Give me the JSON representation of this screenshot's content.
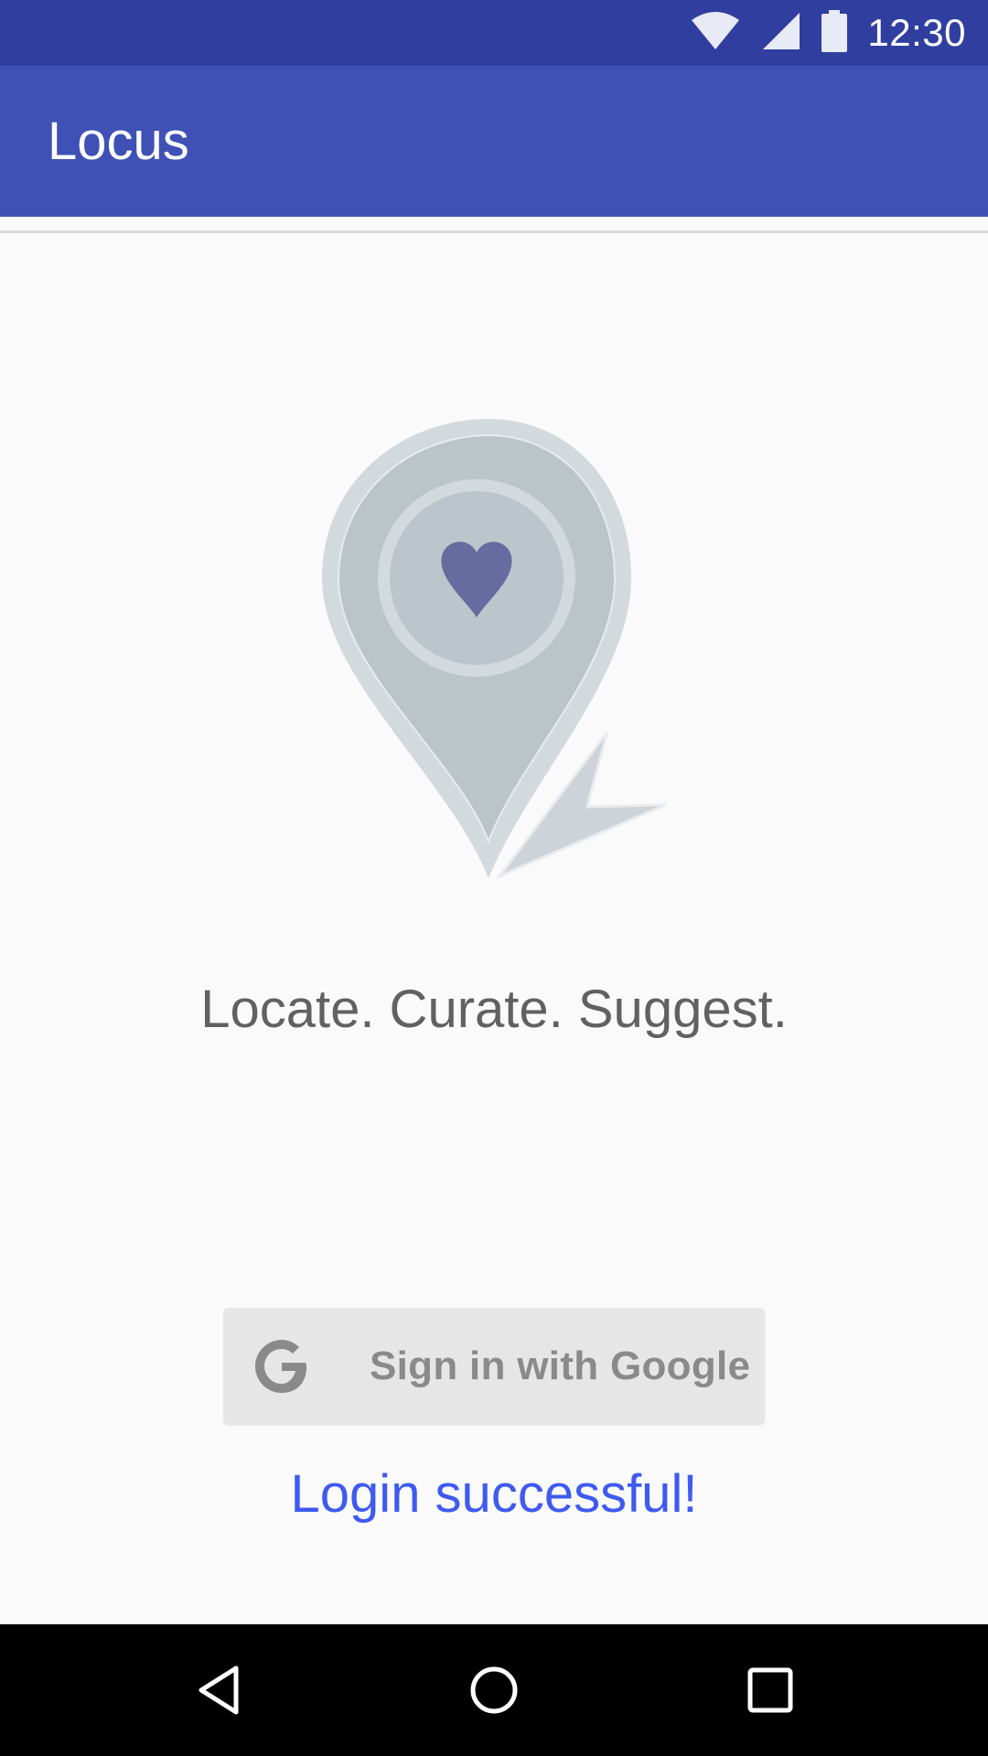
{
  "status_bar": {
    "time": "12:30",
    "icons": [
      "wifi-icon",
      "signal-icon",
      "battery-icon"
    ],
    "color": "#303F9F"
  },
  "app_bar": {
    "title": "Locus",
    "color": "#3F51B5"
  },
  "main": {
    "logo_icon": "map-pin-heart-icon",
    "tagline": "Locate. Curate. Suggest.",
    "sign_in_button": {
      "label": "Sign in with Google",
      "icon": "google-icon"
    },
    "login_status": "Login successful!",
    "login_status_color": "#3F5AF0"
  },
  "nav_bar": {
    "buttons": [
      "back-icon",
      "home-icon",
      "recents-icon"
    ]
  }
}
